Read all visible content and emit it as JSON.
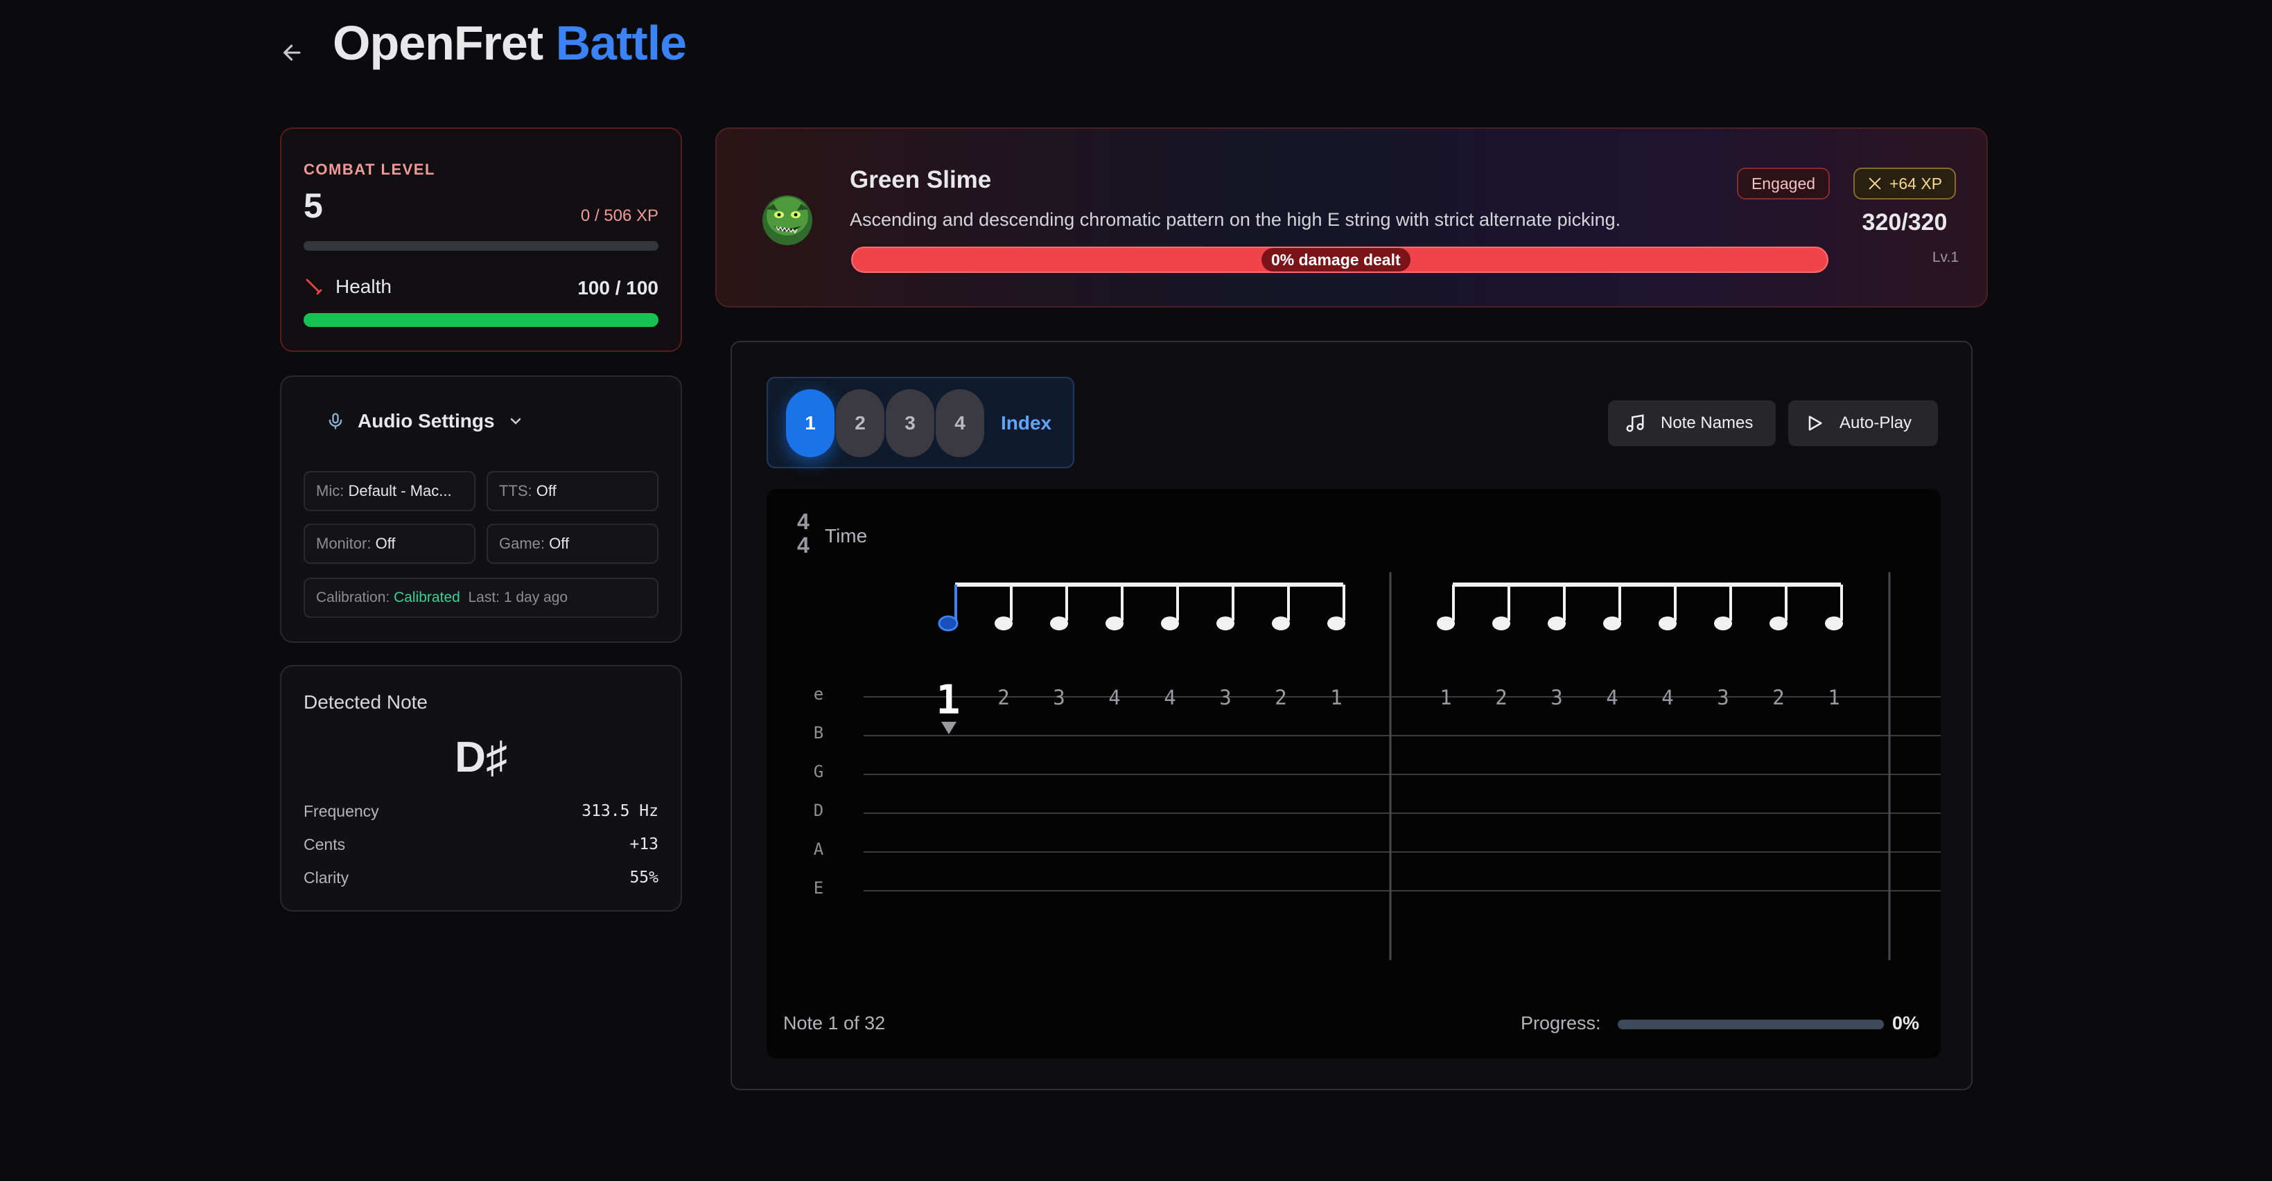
{
  "header": {
    "title_main": "OpenFret",
    "title_accent": "Battle",
    "back_icon": "arrow-left-icon"
  },
  "combat": {
    "label": "COMBAT LEVEL",
    "level": "5",
    "xp": "0 / 506 XP",
    "xp_progress": 0,
    "health_label": "Health",
    "health_value": "100 / 100",
    "health_progress": 1.0,
    "colors": {
      "health": "#16c251",
      "accent_label": "#f29a9a"
    }
  },
  "audio": {
    "title": "Audio Settings",
    "mic_label": "Mic:",
    "mic_value": "Default - Mac...",
    "tts_label": "TTS:",
    "tts_value": "Off",
    "monitor_label": "Monitor:",
    "monitor_value": "Off",
    "game_label": "Game:",
    "game_value": "Off",
    "calibration_label": "Calibration:",
    "calibration_value": "Calibrated",
    "last_label": "Last: 1 day ago"
  },
  "detected": {
    "title": "Detected Note",
    "note": "D♯",
    "rows": [
      {
        "k": "Frequency",
        "v": "313.5 Hz"
      },
      {
        "k": "Cents",
        "v": "+13"
      },
      {
        "k": "Clarity",
        "v": "55%"
      }
    ]
  },
  "enemy": {
    "name": "Green Slime",
    "description": "Ascending and descending chromatic pattern on the high E string with strict alternate picking.",
    "damage_label": "0% damage dealt",
    "damage_progress": 0,
    "status": "Engaged",
    "xp_reward": "+64 XP",
    "hp": "320/320",
    "level": "Lv.1",
    "colors": {
      "hp_bar": "#f0444a"
    }
  },
  "tabs": {
    "items": [
      "1",
      "2",
      "3",
      "4"
    ],
    "active": "1",
    "index_label": "Index"
  },
  "controls": {
    "note_names": "Note Names",
    "auto_play": "Auto-Play"
  },
  "notation": {
    "time_sig_top": "4",
    "time_sig_bottom": "4",
    "time_label": "Time",
    "strings": [
      "e",
      "B",
      "G",
      "D",
      "A",
      "E"
    ],
    "measures": [
      [
        "1",
        "2",
        "3",
        "4",
        "4",
        "3",
        "2",
        "1"
      ],
      [
        "1",
        "2",
        "3",
        "4",
        "4",
        "3",
        "2",
        "1"
      ]
    ],
    "current_note": 0
  },
  "footer": {
    "note_counter": "Note 1 of 32",
    "progress_label": "Progress:",
    "progress_value": "0%",
    "progress": 0
  }
}
